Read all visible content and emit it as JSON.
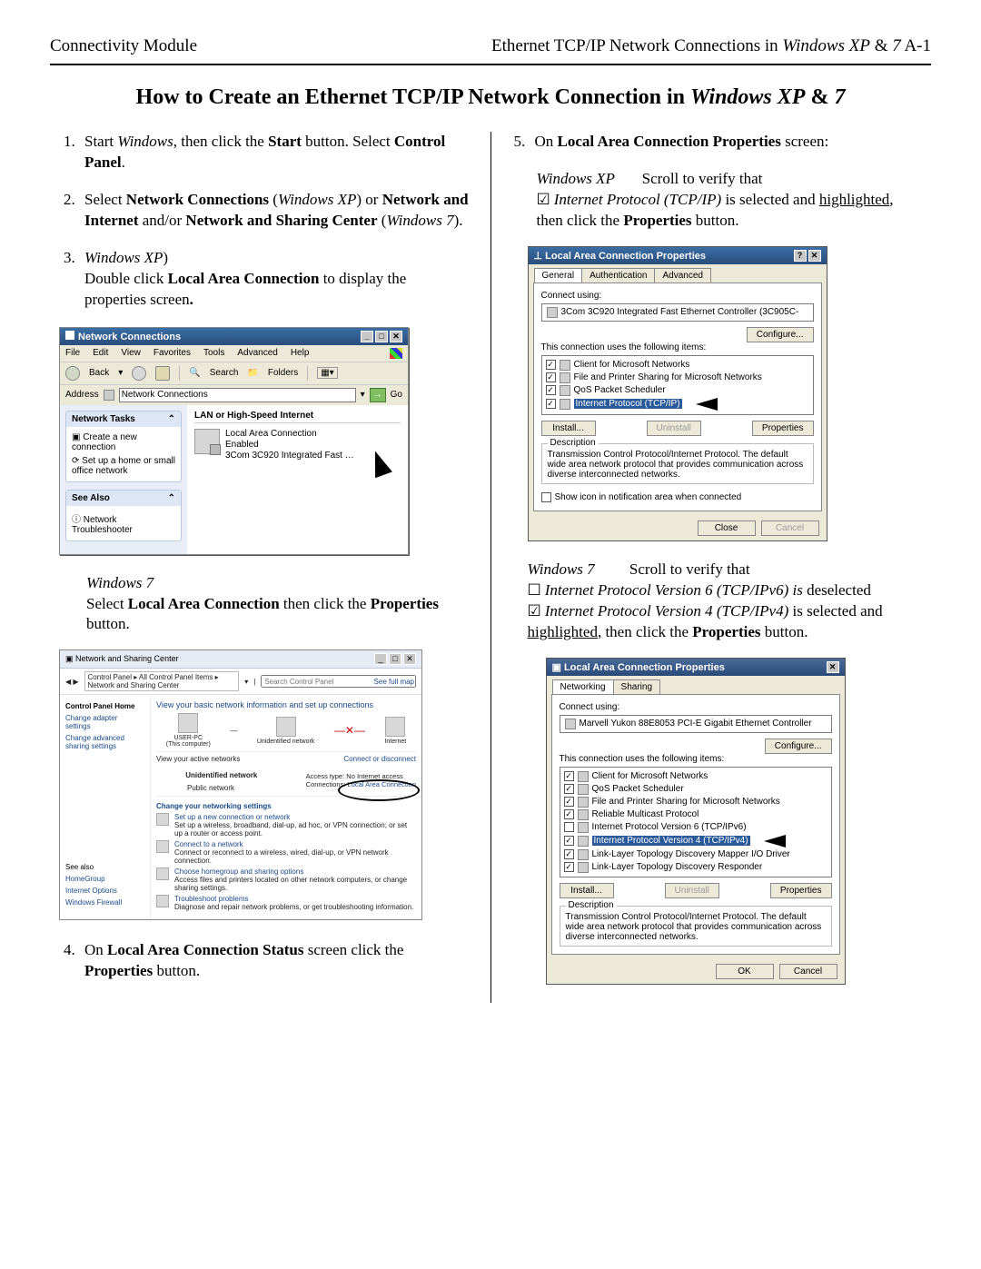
{
  "header": {
    "left": "Connectivity Module",
    "right_text": "Ethernet TCP/IP Network Connections in ",
    "right_os": "Windows XP",
    "right_and": " & ",
    "right_os2": "7",
    "right_page": "    A-1"
  },
  "title_text": "How to Create an Ethernet TCP/IP Network Connection in ",
  "title_os1": "Windows XP",
  "title_and": " & ",
  "title_os2": "7",
  "steps": {
    "s1_a": "Start ",
    "s1_b": "Windows",
    "s1_c": ", then click the ",
    "s1_d": "Start",
    "s1_e": " button. Select ",
    "s1_f": "Control Panel",
    "s1_g": ".",
    "s2_a": "Select ",
    "s2_b": "Network Connections",
    "s2_c": " (",
    "s2_d": "Windows XP",
    "s2_e": ") or ",
    "s2_f": "Network and Internet",
    "s2_g": " and/or ",
    "s2_h": "Network and Sharing Center",
    "s2_i": " (",
    "s2_j": "Windows 7",
    "s2_k": ").",
    "s3_a": "Windows XP",
    "s3_b": ")",
    "s3_c": "Double click ",
    "s3_d": "Local Area Connection",
    "s3_e": " to display the properties screen",
    "s3w7_a": "Windows 7",
    "s3w7_b": "Select ",
    "s3w7_c": "Local Area Connection",
    "s3w7_d": " then click the ",
    "s3w7_e": "Properties",
    "s3w7_f": " button.",
    "s4_a": "On ",
    "s4_b": "Local Area Connection Status",
    "s4_c": " screen click the ",
    "s4_d": "Properties",
    "s4_e": " button.",
    "s5_a": "On ",
    "s5_b": "Local Area Connection Properties",
    "s5_c": " screen:",
    "s5xp_a": "Windows XP",
    "s5xp_b": "Scroll to verify that",
    "s5xp_c": "Internet Protocol (TCP/IP)",
    "s5xp_d": " is selected and ",
    "s5xp_e": "highlighted",
    "s5xp_f": ", then click the ",
    "s5xp_g": "Properties",
    "s5xp_h": " button.",
    "s5w7_a": "Windows 7",
    "s5w7_b": "Scroll to verify that",
    "s5w7_c": "Internet Protocol Version 6 (TCP/IPv6) is",
    "s5w7_d": " deselected",
    "s5w7_e": "Internet Protocol Version 4 (TCP/IPv4)",
    "s5w7_f": " is selected and ",
    "s5w7_g": "highlighted",
    "s5w7_h": ", then click the ",
    "s5w7_i": "Properties",
    "s5w7_j": " button."
  },
  "winXP_explorer": {
    "title": "Network Connections",
    "menu": [
      "File",
      "Edit",
      "View",
      "Favorites",
      "Tools",
      "Advanced",
      "Help"
    ],
    "back": "Back",
    "search": "Search",
    "folders": "Folders",
    "address_label": "Address",
    "address_value": "Network Connections",
    "go": "Go",
    "tasks_title": "Network Tasks",
    "task1": "Create a new connection",
    "task2": "Set up a home or small office network",
    "seealso_title": "See Also",
    "seealso1": "Network Troubleshooter",
    "section": "LAN or High-Speed Internet",
    "conn_name": "Local Area Connection",
    "conn_status": "Enabled",
    "conn_dev": "3Com 3C920 Integrated Fast …"
  },
  "win7_nsc": {
    "title": "Network and Sharing Center",
    "bc": "Control Panel  ▸  All Control Panel Items  ▸  Network and Sharing Center",
    "search_ph": "Search Control Panel",
    "home": "Control Panel Home",
    "l1": "Change adapter settings",
    "l2": "Change advanced sharing settings",
    "h1": "View your basic network information and set up connections",
    "node1": "USER-PC",
    "node1s": "(This computer)",
    "node2": "Unidentified network",
    "node3": "Internet",
    "fullmap": "See full map",
    "active_t": "View your active networks",
    "active_r": "Connect or disconnect",
    "net_name": "Unidentified network",
    "net_type": "Public network",
    "acc_l": "Access type:",
    "acc_v": "No Internet access",
    "conn_l": "Connections:",
    "conn_v": "Local Area Connection",
    "chg_t": "Change your networking settings",
    "o1": "Set up a new connection or network",
    "o1s": "Set up a wireless, broadband, dial-up, ad hoc, or VPN connection; or set up a router or access point.",
    "o2": "Connect to a network",
    "o2s": "Connect or reconnect to a wireless, wired, dial-up, or VPN network connection.",
    "o3": "Choose homegroup and sharing options",
    "o3s": "Access files and printers located on other network computers, or change sharing settings.",
    "o4": "Troubleshoot problems",
    "o4s": "Diagnose and repair network problems, or get troubleshooting information.",
    "sa": "See also",
    "sa1": "HomeGroup",
    "sa2": "Internet Options",
    "sa3": "Windows Firewall"
  },
  "dlgXP": {
    "title": "Local Area Connection Properties",
    "tab1": "General",
    "tab2": "Authentication",
    "tab3": "Advanced",
    "cu": "Connect using:",
    "nic": "3Com 3C920 Integrated Fast Ethernet Controller (3C905C-",
    "cfg": "Configure...",
    "uses": "This connection uses the following items:",
    "i1": "Client for Microsoft Networks",
    "i2": "File and Printer Sharing for Microsoft Networks",
    "i3": "QoS Packet Scheduler",
    "i4": "Internet Protocol (TCP/IP)",
    "install": "Install...",
    "uninstall": "Uninstall",
    "props": "Properties",
    "desc_t": "Description",
    "desc": "Transmission Control Protocol/Internet Protocol. The default wide area network protocol that provides communication across diverse interconnected networks.",
    "showicon": "Show icon in notification area when connected",
    "close": "Close",
    "cancel": "Cancel"
  },
  "dlg7": {
    "title": "Local Area Connection Properties",
    "tab1": "Networking",
    "tab2": "Sharing",
    "cu": "Connect using:",
    "nic": "Marvell Yukon 88E8053 PCI-E Gigabit Ethernet Controller",
    "cfg": "Configure...",
    "uses": "This connection uses the following items:",
    "i1": "Client for Microsoft Networks",
    "i2": "QoS Packet Scheduler",
    "i3": "File and Printer Sharing for Microsoft Networks",
    "i4": "Reliable Multicast Protocol",
    "i5": "Internet Protocol Version 6 (TCP/IPv6)",
    "i6": "Internet Protocol Version 4 (TCP/IPv4)",
    "i7": "Link-Layer Topology Discovery Mapper I/O Driver",
    "i8": "Link-Layer Topology Discovery Responder",
    "install": "Install...",
    "uninstall": "Uninstall",
    "props": "Properties",
    "desc_t": "Description",
    "desc": "Transmission Control Protocol/Internet Protocol. The default wide area network protocol that provides communication across diverse interconnected networks.",
    "ok": "OK",
    "cancel": "Cancel"
  }
}
